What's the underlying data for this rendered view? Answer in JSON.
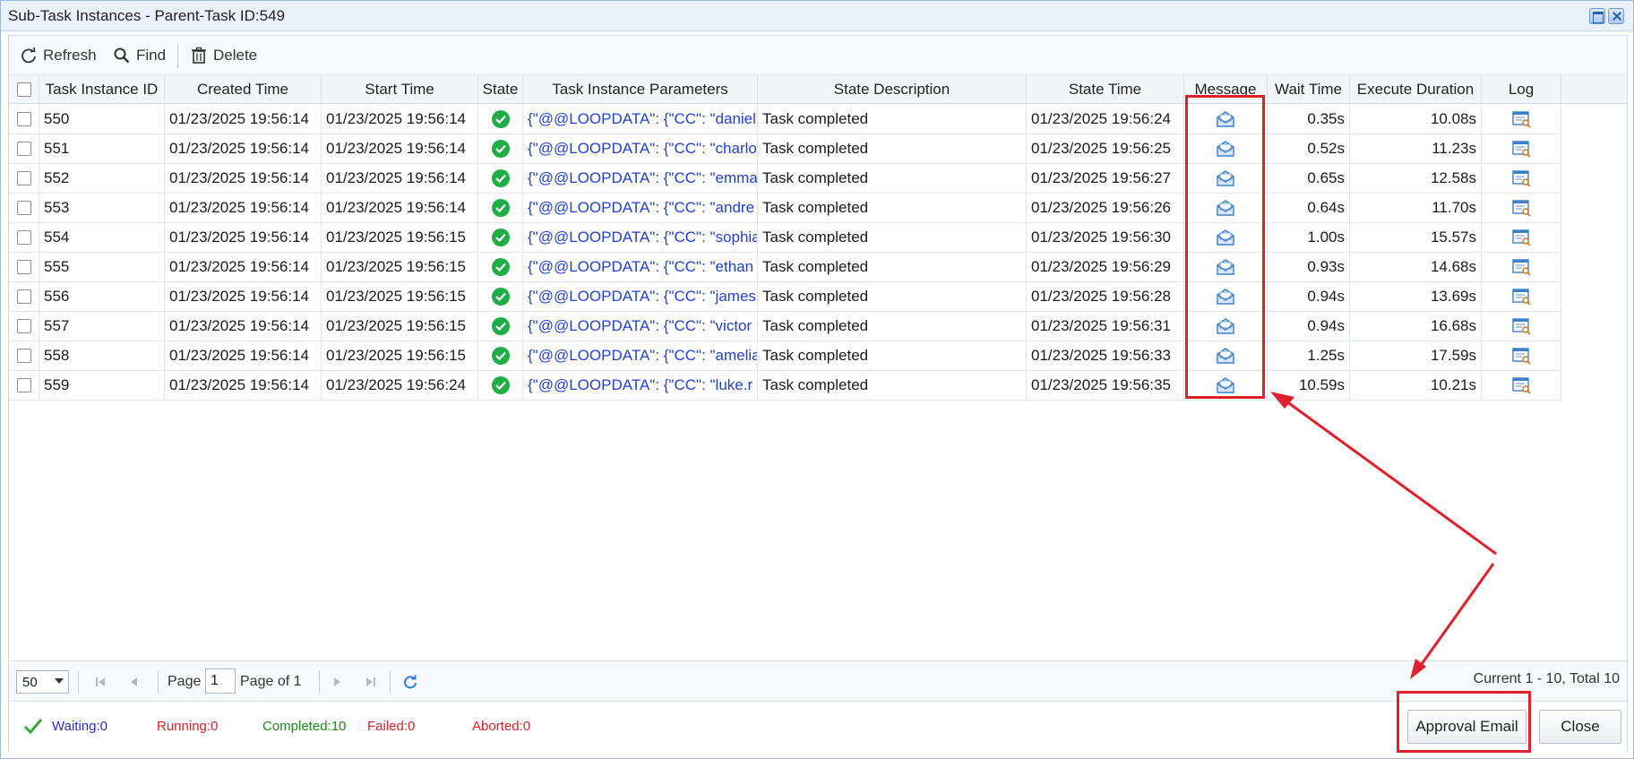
{
  "window": {
    "title": "Sub-Task Instances - Parent-Task ID:549"
  },
  "toolbar": {
    "refresh_label": "Refresh",
    "find_label": "Find",
    "delete_label": "Delete"
  },
  "columns": {
    "id": "Task Instance ID",
    "created": "Created Time",
    "start": "Start Time",
    "state": "State",
    "params": "Task Instance Parameters",
    "desc": "State Description",
    "state_time": "State Time",
    "message": "Message",
    "wait": "Wait Time",
    "duration": "Execute Duration",
    "log": "Log"
  },
  "rows": [
    {
      "id": "550",
      "created": "01/23/2025 19:56:14",
      "start": "01/23/2025 19:56:14",
      "params": "{\"@@LOOPDATA\": {\"CC\": \"daniel",
      "desc": "Task completed",
      "state_time": "01/23/2025 19:56:24",
      "wait": "0.35s",
      "duration": "10.08s"
    },
    {
      "id": "551",
      "created": "01/23/2025 19:56:14",
      "start": "01/23/2025 19:56:14",
      "params": "{\"@@LOOPDATA\": {\"CC\": \"charlo",
      "desc": "Task completed",
      "state_time": "01/23/2025 19:56:25",
      "wait": "0.52s",
      "duration": "11.23s"
    },
    {
      "id": "552",
      "created": "01/23/2025 19:56:14",
      "start": "01/23/2025 19:56:14",
      "params": "{\"@@LOOPDATA\": {\"CC\": \"emma",
      "desc": "Task completed",
      "state_time": "01/23/2025 19:56:27",
      "wait": "0.65s",
      "duration": "12.58s"
    },
    {
      "id": "553",
      "created": "01/23/2025 19:56:14",
      "start": "01/23/2025 19:56:14",
      "params": "{\"@@LOOPDATA\": {\"CC\": \"andre",
      "desc": "Task completed",
      "state_time": "01/23/2025 19:56:26",
      "wait": "0.64s",
      "duration": "11.70s"
    },
    {
      "id": "554",
      "created": "01/23/2025 19:56:14",
      "start": "01/23/2025 19:56:15",
      "params": "{\"@@LOOPDATA\": {\"CC\": \"sophia",
      "desc": "Task completed",
      "state_time": "01/23/2025 19:56:30",
      "wait": "1.00s",
      "duration": "15.57s"
    },
    {
      "id": "555",
      "created": "01/23/2025 19:56:14",
      "start": "01/23/2025 19:56:15",
      "params": "{\"@@LOOPDATA\": {\"CC\": \"ethan",
      "desc": "Task completed",
      "state_time": "01/23/2025 19:56:29",
      "wait": "0.93s",
      "duration": "14.68s"
    },
    {
      "id": "556",
      "created": "01/23/2025 19:56:14",
      "start": "01/23/2025 19:56:15",
      "params": "{\"@@LOOPDATA\": {\"CC\": \"james",
      "desc": "Task completed",
      "state_time": "01/23/2025 19:56:28",
      "wait": "0.94s",
      "duration": "13.69s"
    },
    {
      "id": "557",
      "created": "01/23/2025 19:56:14",
      "start": "01/23/2025 19:56:15",
      "params": "{\"@@LOOPDATA\": {\"CC\": \"victor",
      "desc": "Task completed",
      "state_time": "01/23/2025 19:56:31",
      "wait": "0.94s",
      "duration": "16.68s"
    },
    {
      "id": "558",
      "created": "01/23/2025 19:56:14",
      "start": "01/23/2025 19:56:15",
      "params": "{\"@@LOOPDATA\": {\"CC\": \"amelia",
      "desc": "Task completed",
      "state_time": "01/23/2025 19:56:33",
      "wait": "1.25s",
      "duration": "17.59s"
    },
    {
      "id": "559",
      "created": "01/23/2025 19:56:14",
      "start": "01/23/2025 19:56:24",
      "params": "{\"@@LOOPDATA\": {\"CC\": \"luke.r",
      "desc": "Task completed",
      "state_time": "01/23/2025 19:56:35",
      "wait": "10.59s",
      "duration": "10.21s"
    }
  ],
  "pager": {
    "page_size": "50",
    "page_label": "Page",
    "page_value": "1",
    "page_of": "Page of 1",
    "summary": "Current 1 - 10, Total 10"
  },
  "status": {
    "waiting": "Waiting:0",
    "running": "Running:0",
    "completed": "Completed:10",
    "failed": "Failed:0",
    "aborted": "Aborted:0"
  },
  "buttons": {
    "approval_email": "Approval Email",
    "close": "Close"
  },
  "colors": {
    "params_link": "#1f3fd6",
    "state_ok": "#1fae45",
    "highlight": "#e0202a",
    "waiting": "#2a2ad6",
    "running": "#e0202a",
    "completed": "#1a8a1a",
    "failed": "#e0202a",
    "aborted": "#e0202a"
  }
}
